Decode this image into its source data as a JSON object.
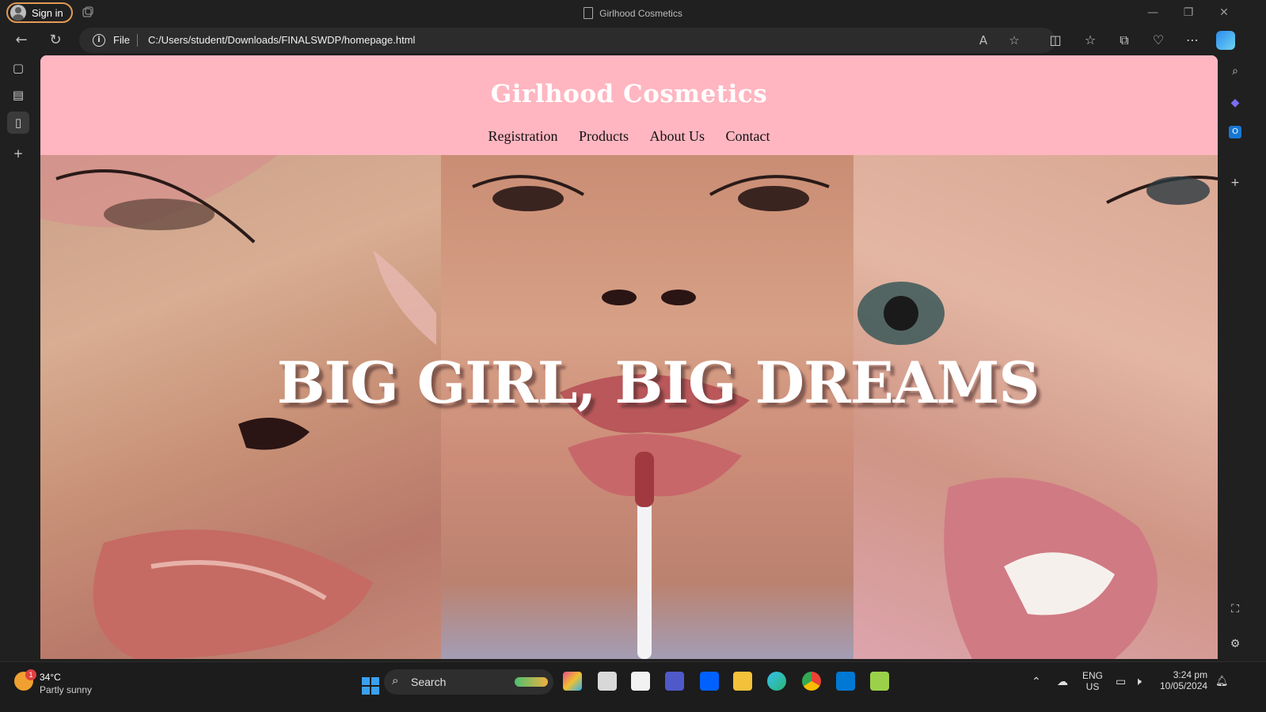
{
  "browser": {
    "signin_label": "Sign in",
    "tab_title": "Girlhood Cosmetics",
    "url_scheme": "File",
    "url": "C:/Users/student/Downloads/FINALSWDP/homepage.html"
  },
  "site": {
    "title": "Girlhood Cosmetics",
    "nav": [
      "Registration",
      "Products",
      "About Us",
      "Contact"
    ],
    "hero_text": "BIG GIRL, BIG DREAMS",
    "header_color": "#ffb6c1"
  },
  "taskbar": {
    "weather_temp": "34°C",
    "weather_cond": "Partly sunny",
    "weather_badge": "1",
    "search_label": "Search",
    "lang": "ENG",
    "region": "US",
    "time": "3:24 pm",
    "date": "10/05/2024"
  }
}
